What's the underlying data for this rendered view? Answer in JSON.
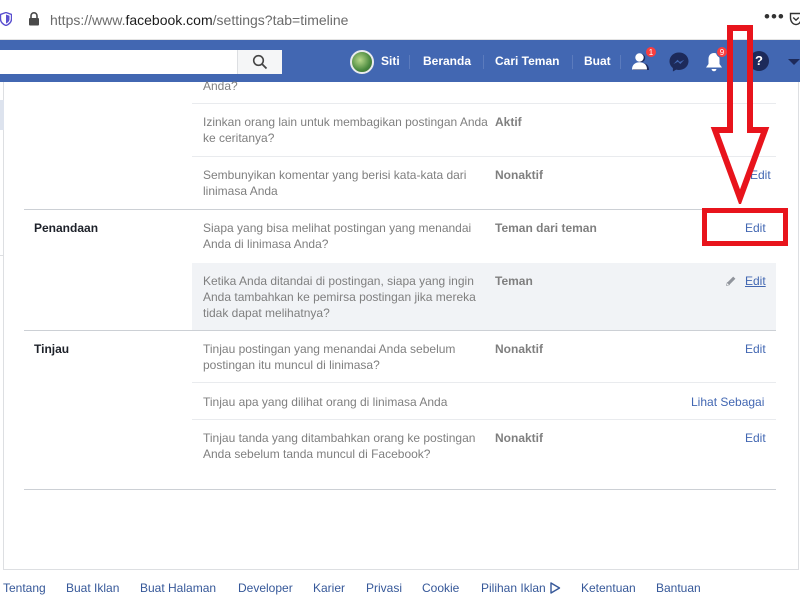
{
  "browser": {
    "url_prefix": "https://www.",
    "url_domain": "facebook.com",
    "url_path": "/settings?tab=timeline",
    "menu_label": "•••"
  },
  "topbar": {
    "user_name": "Siti",
    "nav": [
      "Beranda",
      "Cari Teman",
      "Buat"
    ],
    "friend_requests_badge": "1",
    "notifications_badge": "9",
    "help_label": "?"
  },
  "sections": {
    "partial_row": {
      "desc_tail": "Anda?"
    },
    "share_row": {
      "desc": "Izinkan orang lain untuk membagikan postingan Anda ke ceritanya?",
      "value": "Aktif"
    },
    "hide_row": {
      "desc": "Sembunyikan komentar yang berisi kata-kata dari linimasa Anda",
      "value": "Nonaktif",
      "action": "Edit"
    },
    "penandaan": {
      "title": "Penandaan",
      "rows": [
        {
          "desc": "Siapa yang bisa melihat postingan yang menandai Anda di linimasa Anda?",
          "value": "Teman dari teman",
          "action": "Edit"
        },
        {
          "desc": "Ketika Anda ditandai di postingan, siapa yang ingin Anda tambahkan ke pemirsa postingan jika mereka tidak dapat melihatnya?",
          "value": "Teman",
          "action": "Edit"
        }
      ]
    },
    "tinjau": {
      "title": "Tinjau",
      "rows": [
        {
          "desc": "Tinjau postingan yang menandai Anda sebelum postingan itu muncul di linimasa?",
          "value": "Nonaktif",
          "action": "Edit"
        },
        {
          "desc": "Tinjau apa yang dilihat orang di linimasa Anda",
          "value": "",
          "action": "Lihat Sebagai"
        },
        {
          "desc": "Tinjau tanda yang ditambahkan orang ke postingan Anda sebelum tanda muncul di Facebook?",
          "value": "Nonaktif",
          "action": "Edit"
        }
      ]
    }
  },
  "footer": {
    "links": [
      "Tentang",
      "Buat Iklan",
      "Buat Halaman",
      "Developer",
      "Karier",
      "Privasi",
      "Cookie",
      "Pilihan Iklan",
      "Ketentuan",
      "Bantuan"
    ]
  },
  "colors": {
    "facebook_blue": "#4267b2",
    "link_blue": "#4267b2",
    "annotation_red": "#e8141c"
  }
}
